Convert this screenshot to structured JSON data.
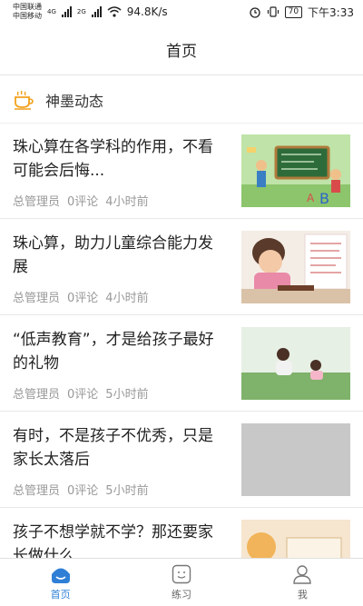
{
  "status": {
    "carrier1": "中国联通",
    "carrier2": "中国移动",
    "net1": "4G",
    "net2": "2G",
    "speed": "94.8K/s",
    "battery": "70",
    "time": "下午3:33"
  },
  "header": {
    "title": "首页"
  },
  "section": {
    "icon": "cup-icon",
    "label": "神墨动态"
  },
  "articles": [
    {
      "title": "珠心算在各学科的作用，不看可能会后悔...",
      "author": "总管理员",
      "comments": "0评论",
      "time": "4小时前"
    },
    {
      "title": "珠心算，助力儿童综合能力发展",
      "author": "总管理员",
      "comments": "0评论",
      "time": "4小时前"
    },
    {
      "title": "“低声教育”，才是给孩子最好的礼物",
      "author": "总管理员",
      "comments": "0评论",
      "time": "5小时前"
    },
    {
      "title": "有时，不是孩子不优秀，只是家长太落后",
      "author": "总管理员",
      "comments": "0评论",
      "time": "5小时前"
    },
    {
      "title": "孩子不想学就不学？那还要家长做什么",
      "author": "",
      "comments": "",
      "time": ""
    }
  ],
  "tabs": [
    {
      "label": "首页",
      "icon": "home-icon"
    },
    {
      "label": "练习",
      "icon": "smile-face-icon"
    },
    {
      "label": "我",
      "icon": "user-icon"
    }
  ],
  "colors": {
    "accent": "#2f7fd6",
    "meta": "#999999"
  }
}
